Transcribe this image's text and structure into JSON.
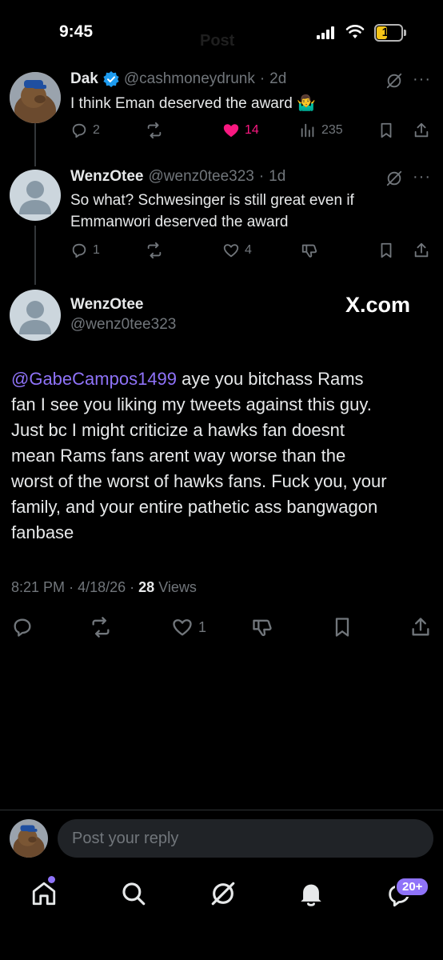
{
  "status_bar": {
    "time": "9:45",
    "battery": "15",
    "ghost_title": "Post"
  },
  "thread": [
    {
      "name": "Dak",
      "verified": true,
      "handle": "@cashmoneydrunk",
      "time": "2d",
      "text": "I think Eman deserved the award",
      "emoji": "🤷‍♂️",
      "replies": "2",
      "likes": "14",
      "liked": true,
      "views": "235"
    },
    {
      "name": "WenzOtee",
      "verified": false,
      "handle": "@wenz0tee323",
      "time": "1d",
      "text_line1": "So what? Schwesinger is still great even if",
      "text_line2": "Emmanwori deserved the award",
      "replies": "1",
      "likes": "4"
    }
  ],
  "main_post": {
    "name": "WenzOtee",
    "handle": "@wenz0tee323",
    "watermark": "X.com",
    "mention": "@GabeCampos1499",
    "lines": [
      " aye you bitchass  Rams",
      "fan I see you liking my tweets against this guy.",
      "Just bc I might criticize a hawks fan doesnt",
      "mean Rams fans arent way worse than the",
      "worst of the worst of hawks fans. Fuck you, your",
      "family, and your entire pathetic ass bangwagon",
      "fanbase"
    ],
    "time": "8:21 PM",
    "date": "4/18/26",
    "views_count": "28",
    "views_label": "Views",
    "likes": "1"
  },
  "reply": {
    "placeholder": "Post your reply"
  },
  "tab_bar": {
    "messages_badge": "20+"
  },
  "colors": {
    "like": "#f91880",
    "mention": "#8f73f9",
    "muted": "#71767b",
    "verified": "#1d9bf0"
  }
}
